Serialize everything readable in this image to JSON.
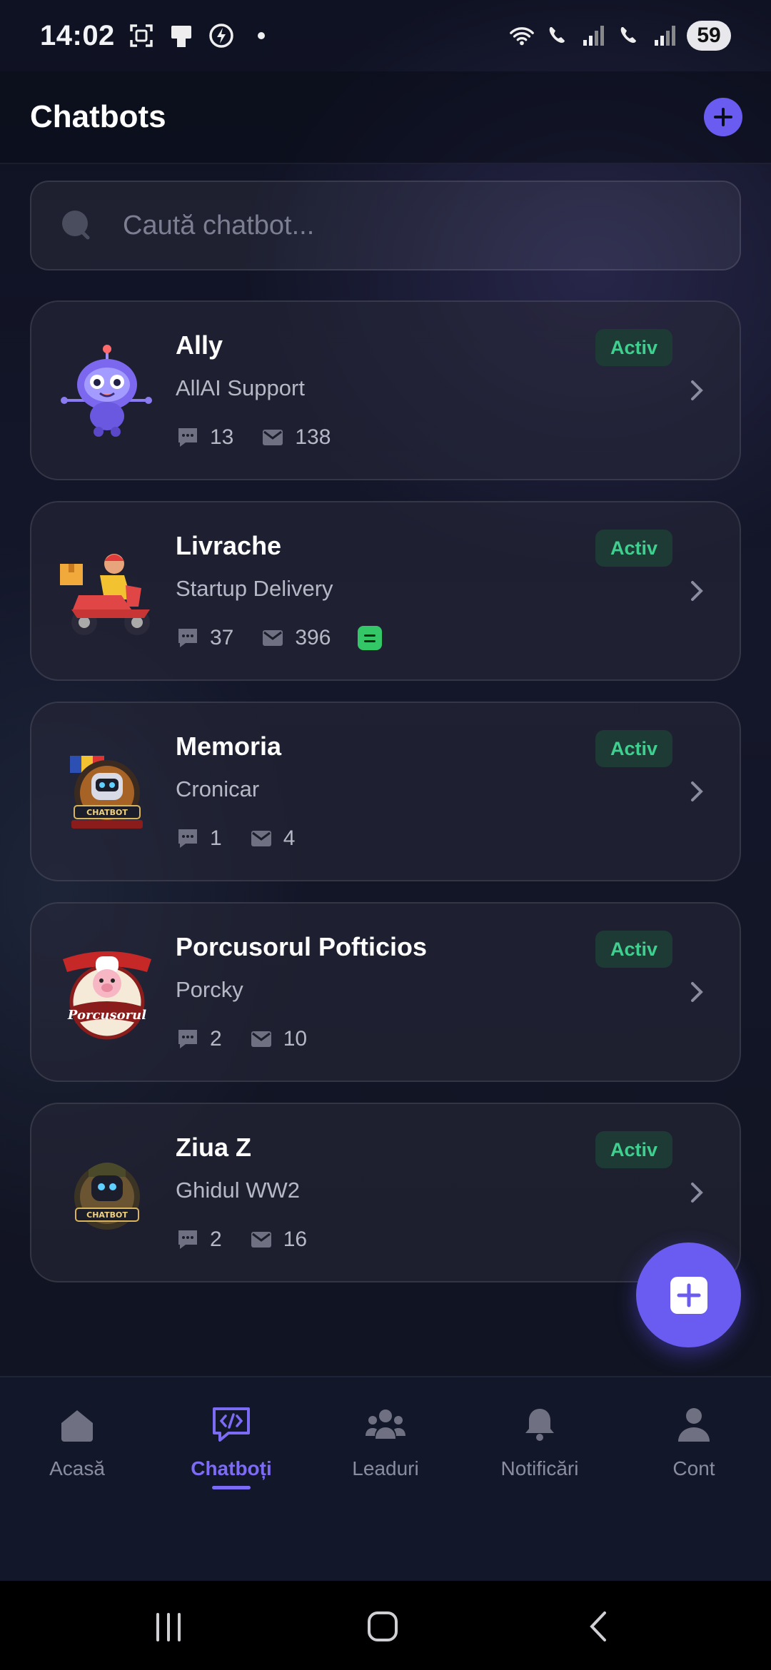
{
  "status_bar": {
    "time": "14:02",
    "battery": "59",
    "icons": [
      "screenshot-icon",
      "screen-icon",
      "charging-icon",
      "dot-icon",
      "wifi-icon",
      "call-sim1-icon",
      "signal-icon",
      "call-sim2-icon",
      "signal-icon"
    ]
  },
  "header": {
    "title": "Chatbots",
    "add_icon": "plus-icon"
  },
  "search": {
    "placeholder": "Caută chatbot...",
    "value": ""
  },
  "chatbots": [
    {
      "name": "Ally",
      "subtitle": "AllAI Support",
      "conversations": "13",
      "messages": "138",
      "status": "Activ",
      "avatar": "robot-mascot",
      "has_doc_badge": false
    },
    {
      "name": "Livrache",
      "subtitle": "Startup Delivery",
      "conversations": "37",
      "messages": "396",
      "status": "Activ",
      "avatar": "delivery-scooter",
      "has_doc_badge": true
    },
    {
      "name": "Memoria",
      "subtitle": "Cronicar",
      "conversations": "1",
      "messages": "4",
      "status": "Activ",
      "avatar": "chatbot-revolution-emblem",
      "has_doc_badge": false
    },
    {
      "name": "Porcusorul Pofticios",
      "subtitle": "Porcky",
      "conversations": "2",
      "messages": "10",
      "status": "Activ",
      "avatar": "pig-chef-emblem",
      "has_doc_badge": false
    },
    {
      "name": "Ziua Z",
      "subtitle": "Ghidul WW2",
      "conversations": "2",
      "messages": "16",
      "status": "Activ",
      "avatar": "chatbot-ww2-emblem",
      "has_doc_badge": false
    }
  ],
  "fab": {
    "icon": "plus-square-icon"
  },
  "bottom_nav": {
    "items": [
      {
        "label": "Acasă",
        "icon": "home-icon",
        "active": false
      },
      {
        "label": "Chatboți",
        "icon": "code-chat-icon",
        "active": true
      },
      {
        "label": "Leaduri",
        "icon": "people-icon",
        "active": false
      },
      {
        "label": "Notificări",
        "icon": "bell-icon",
        "active": false
      },
      {
        "label": "Cont",
        "icon": "user-icon",
        "active": false
      }
    ]
  },
  "colors": {
    "accent": "#6a5cf0",
    "status_active": "#3fcf8e",
    "background": "#0f1222"
  }
}
